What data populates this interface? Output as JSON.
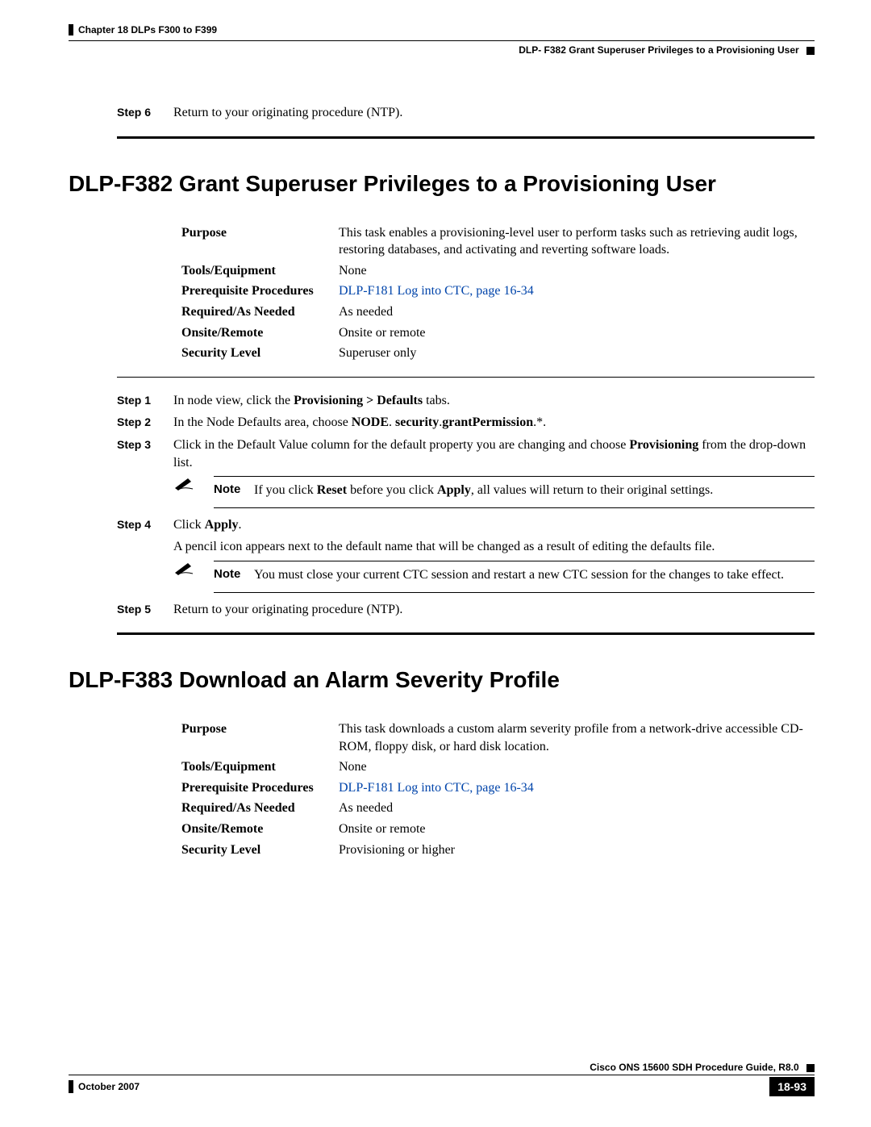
{
  "header": {
    "chapter": "Chapter 18 DLPs F300 to F399",
    "section": "DLP- F382 Grant Superuser Privileges to a Provisioning User"
  },
  "prev_step6": {
    "num": "Step 6",
    "text": "Return to your originating procedure (NTP)."
  },
  "f382": {
    "title": "DLP-F382 Grant Superuser Privileges to a Provisioning User",
    "purpose_label": "Purpose",
    "purpose": "This task enables a provisioning-level user to perform tasks such as retrieving audit logs, restoring databases, and activating and reverting software loads.",
    "tools_label": "Tools/Equipment",
    "tools": "None",
    "prereq_label": "Prerequisite Procedures",
    "prereq": "DLP-F181 Log into CTC, page 16-34",
    "req_label": "Required/As Needed",
    "req": "As needed",
    "onsite_label": "Onsite/Remote",
    "onsite": "Onsite or remote",
    "sec_label": "Security Level",
    "sec": "Superuser only",
    "step1": {
      "num": "Step 1",
      "pre": "In node view, click the ",
      "bold": "Provisioning > Defaults",
      "post": " tabs."
    },
    "step2": {
      "num": "Step 2",
      "pre": "In the Node Defaults area, choose ",
      "bold": "NODE",
      "mid": ". ",
      "bold2": "security",
      "mid2": ".",
      "bold3": "grantPermission",
      "post": ".*."
    },
    "step3": {
      "num": "Step 3",
      "pre": "Click in the Default Value column for the default property you are changing and choose ",
      "bold": "Provisioning",
      "post": " from the drop-down list."
    },
    "note1": {
      "label": "Note",
      "pre": "If you click ",
      "b1": "Reset",
      "mid": " before you click ",
      "b2": "Apply",
      "post": ", all values will return to their original settings."
    },
    "step4": {
      "num": "Step 4",
      "pre": "Click ",
      "bold": "Apply",
      "post": "."
    },
    "step4_extra": "A pencil icon appears next to the default name that will be changed as a result of editing the defaults file.",
    "note2": {
      "label": "Note",
      "text": "You must close your current CTC session and restart a new CTC session for the changes to take effect."
    },
    "step5": {
      "num": "Step 5",
      "text": "Return to your originating procedure (NTP)."
    }
  },
  "f383": {
    "title": "DLP-F383 Download an Alarm Severity Profile",
    "purpose_label": "Purpose",
    "purpose": "This task downloads a custom alarm severity profile from a network-drive accessible CD-ROM, floppy disk, or hard disk location.",
    "tools_label": "Tools/Equipment",
    "tools": "None",
    "prereq_label": "Prerequisite Procedures",
    "prereq": "DLP-F181 Log into CTC, page 16-34",
    "req_label": "Required/As Needed",
    "req": "As needed",
    "onsite_label": "Onsite/Remote",
    "onsite": "Onsite or remote",
    "sec_label": "Security Level",
    "sec": "Provisioning or higher"
  },
  "footer": {
    "guide": "Cisco ONS 15600 SDH Procedure Guide, R8.0",
    "date": "October 2007",
    "page": "18-93"
  }
}
